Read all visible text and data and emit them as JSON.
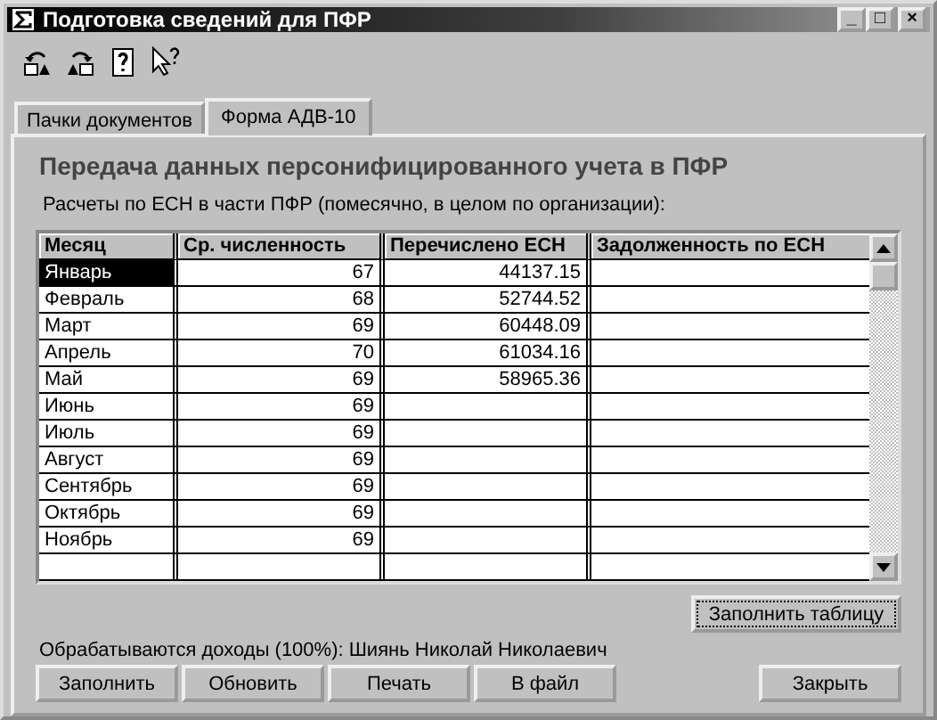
{
  "window": {
    "title": "Подготовка сведений для ПФР",
    "controls": [
      "_",
      "□",
      "×"
    ]
  },
  "toolbar": [
    {
      "kind": "undo"
    },
    {
      "kind": "redo"
    },
    {
      "kind": "help"
    },
    {
      "kind": "pointer-help"
    }
  ],
  "tabs": [
    {
      "label": "Пачки документов",
      "selected": false
    },
    {
      "label": "Форма АДВ-10",
      "selected": true
    }
  ],
  "heading": "Передача данных персонифицированного учета в ПФР",
  "subheading": "Расчеты по ЕСН в части ПФР (помесячно, в целом по организации):",
  "table": {
    "columns": [
      "Месяц",
      "Ср. численность",
      "Перечислено ЕСН",
      "Задолженность по ЕСН"
    ],
    "rows": [
      {
        "cells": [
          "Январь",
          "67",
          "44137.15",
          ""
        ],
        "selected": true
      },
      {
        "cells": [
          "Февраль",
          "68",
          "52744.52",
          ""
        ],
        "selected": false
      },
      {
        "cells": [
          "Март",
          "69",
          "60448.09",
          ""
        ],
        "selected": false
      },
      {
        "cells": [
          "Апрель",
          "70",
          "61034.16",
          ""
        ],
        "selected": false
      },
      {
        "cells": [
          "Май",
          "69",
          "58965.36",
          ""
        ],
        "selected": false
      },
      {
        "cells": [
          "Июнь",
          "69",
          "",
          ""
        ],
        "selected": false
      },
      {
        "cells": [
          "Июль",
          "69",
          "",
          ""
        ],
        "selected": false
      },
      {
        "cells": [
          "Август",
          "69",
          "",
          ""
        ],
        "selected": false
      },
      {
        "cells": [
          "Сентябрь",
          "69",
          "",
          ""
        ],
        "selected": false
      },
      {
        "cells": [
          "Октябрь",
          "69",
          "",
          ""
        ],
        "selected": false
      },
      {
        "cells": [
          "Ноябрь",
          "69",
          "",
          ""
        ],
        "selected": false
      },
      {
        "cells": [
          "",
          "",
          "",
          ""
        ],
        "selected": false
      }
    ]
  },
  "fill_table_button": "Заполнить таблицу",
  "status": "Обрабатываются доходы (100%): Шиянь Николай Николаевич",
  "buttons": [
    {
      "label": "Заполнить",
      "kind": "left"
    },
    {
      "label": "Обновить",
      "kind": "left"
    },
    {
      "label": "Печать",
      "kind": "left"
    },
    {
      "label": "В файл",
      "kind": "left"
    },
    {
      "label": "Закрыть",
      "kind": "right"
    }
  ]
}
